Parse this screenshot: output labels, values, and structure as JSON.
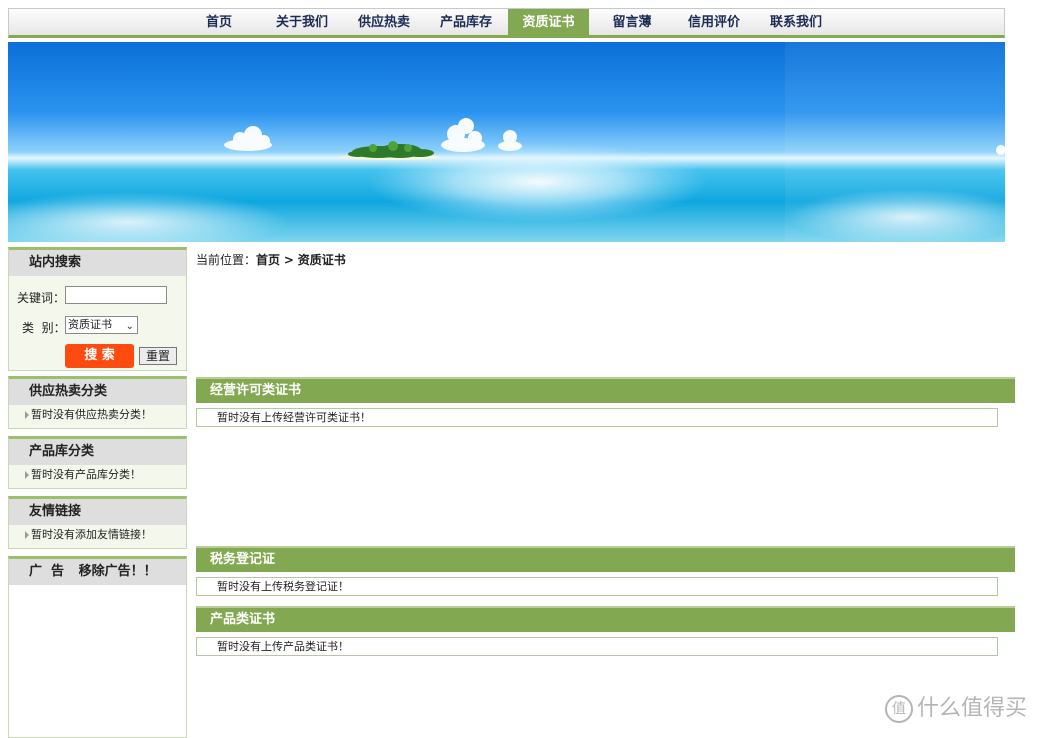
{
  "nav": {
    "items": [
      {
        "label": "首页"
      },
      {
        "label": "关于我们"
      },
      {
        "label": "供应热卖"
      },
      {
        "label": "产品库存"
      },
      {
        "label": "资质证书",
        "active": true
      },
      {
        "label": "留言薄"
      },
      {
        "label": "信用评价"
      },
      {
        "label": "联系我们"
      }
    ]
  },
  "sidebar": {
    "search": {
      "title": "站内搜索",
      "keyword_label": "关键词：",
      "keyword_value": "",
      "category_label": "类  别：",
      "category_selected": "资质证书",
      "search_button": "搜 索",
      "reset_button": "重置"
    },
    "supply_categories": {
      "title": "供应热卖分类",
      "empty": "暂时没有供应热卖分类！"
    },
    "product_categories": {
      "title": "产品库分类",
      "empty": "暂时没有产品库分类！"
    },
    "links": {
      "title": "友情链接",
      "empty": "暂时没有添加友情链接！"
    },
    "ads": {
      "title": "广  告",
      "remove": "移除广告！！"
    }
  },
  "breadcrumb": {
    "prefix": "当前位置：",
    "home": "首页",
    "separator": ">",
    "current": "资质证书"
  },
  "sections": [
    {
      "title": "经营许可类证书",
      "empty": "暂时没有上传经营许可类证书！"
    },
    {
      "title": "税务登记证",
      "empty": "暂时没有上传税务登记证！"
    },
    {
      "title": "产品类证书",
      "empty": "暂时没有上传产品类证书！"
    }
  ],
  "watermark": {
    "text": "什么值得买",
    "icon": "zhi-logo-icon"
  },
  "colors": {
    "accent_green": "#82a951",
    "search_button": "#ff4b0f",
    "nav_text": "#1d2c55"
  }
}
